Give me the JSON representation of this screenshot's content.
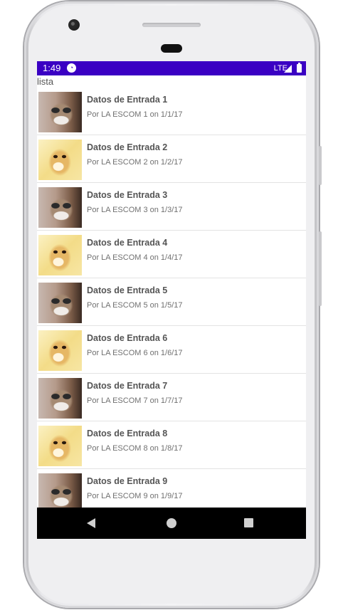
{
  "status_bar": {
    "time": "1:49",
    "network": "LTE",
    "notification_icon": "app-notification-icon"
  },
  "app": {
    "title": "lista"
  },
  "items": [
    {
      "title": "Datos de Entrada 1",
      "subtitle": "Por LA ESCOM 1 on 1/1/17",
      "image": "grumpy-cat"
    },
    {
      "title": "Datos de Entrada 2",
      "subtitle": "Por LA ESCOM 2 on 1/2/17",
      "image": "doge"
    },
    {
      "title": "Datos de Entrada 3",
      "subtitle": "Por LA ESCOM 3 on 1/3/17",
      "image": "grumpy-cat"
    },
    {
      "title": "Datos de Entrada 4",
      "subtitle": "Por LA ESCOM 4 on 1/4/17",
      "image": "doge"
    },
    {
      "title": "Datos de Entrada 5",
      "subtitle": "Por LA ESCOM 5 on 1/5/17",
      "image": "grumpy-cat"
    },
    {
      "title": "Datos de Entrada 6",
      "subtitle": "Por LA ESCOM 6 on 1/6/17",
      "image": "doge"
    },
    {
      "title": "Datos de Entrada 7",
      "subtitle": "Por LA ESCOM 7 on 1/7/17",
      "image": "grumpy-cat"
    },
    {
      "title": "Datos de Entrada 8",
      "subtitle": "Por LA ESCOM 8 on 1/8/17",
      "image": "doge"
    },
    {
      "title": "Datos de Entrada 9",
      "subtitle": "Por LA ESCOM 9 on 1/9/17",
      "image": "grumpy-cat"
    }
  ],
  "colors": {
    "status_bar": "#3a00c3",
    "nav_bar": "#000000"
  }
}
